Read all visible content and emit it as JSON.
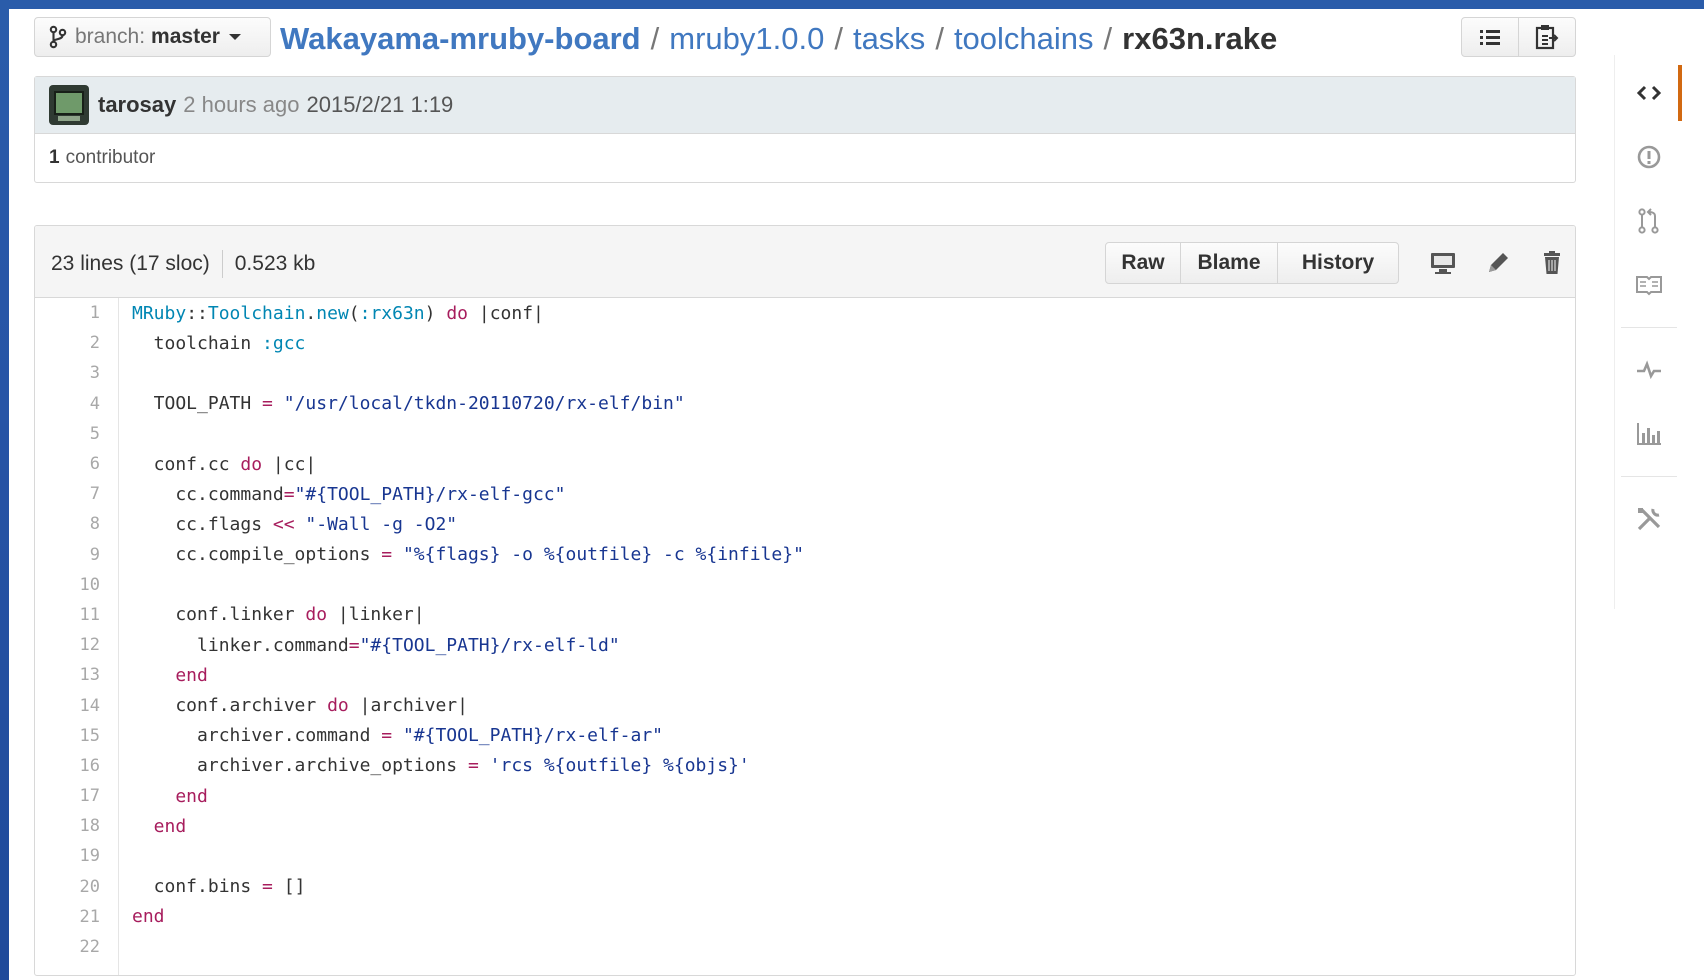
{
  "branch": {
    "label": "branch:",
    "name": "master"
  },
  "breadcrumb": {
    "repo": "Wakayama-mruby-board",
    "sep": "/",
    "parts": [
      "mruby1.0.0",
      "tasks",
      "toolchains"
    ],
    "file": "rx63n.rake"
  },
  "commit": {
    "author": "tarosay",
    "ago": "2 hours ago",
    "date": "2015/2/21 1:19",
    "contributors_count": "1",
    "contributors_label": "contributor"
  },
  "file": {
    "lines_info": "23 lines (17 sloc)",
    "size": "0.523 kb",
    "buttons": {
      "raw": "Raw",
      "blame": "Blame",
      "history": "History"
    }
  },
  "code_lines": [
    [
      [
        "c",
        "MRuby"
      ],
      [
        "p",
        "::"
      ],
      [
        "c",
        "Toolchain"
      ],
      [
        "p",
        "."
      ],
      [
        "c",
        "new"
      ],
      [
        "p",
        "("
      ],
      [
        "c",
        ":rx63n"
      ],
      [
        "p",
        ") "
      ],
      [
        "k",
        "do"
      ],
      [
        "p",
        " |conf|"
      ]
    ],
    [
      [
        "p",
        "  toolchain "
      ],
      [
        "c",
        ":gcc"
      ]
    ],
    [],
    [
      [
        "p",
        "  TOOL_PATH "
      ],
      [
        "k",
        "="
      ],
      [
        "p",
        " "
      ],
      [
        "s",
        "\"/usr/local/tkdn-20110720/rx-elf/bin\""
      ]
    ],
    [],
    [
      [
        "p",
        "  conf.cc "
      ],
      [
        "k",
        "do"
      ],
      [
        "p",
        " |cc|"
      ]
    ],
    [
      [
        "p",
        "    cc.command"
      ],
      [
        "k",
        "="
      ],
      [
        "s",
        "\"#{TOOL_PATH}/rx-elf-gcc\""
      ]
    ],
    [
      [
        "p",
        "    cc.flags "
      ],
      [
        "k",
        "<<"
      ],
      [
        "p",
        " "
      ],
      [
        "s",
        "\"-Wall -g -O2\""
      ]
    ],
    [
      [
        "p",
        "    cc.compile_options "
      ],
      [
        "k",
        "="
      ],
      [
        "p",
        " "
      ],
      [
        "s",
        "\"%{flags} -o %{outfile} -c %{infile}\""
      ]
    ],
    [],
    [
      [
        "p",
        "    conf.linker "
      ],
      [
        "k",
        "do"
      ],
      [
        "p",
        " |linker|"
      ]
    ],
    [
      [
        "p",
        "      linker.command"
      ],
      [
        "k",
        "="
      ],
      [
        "s",
        "\"#{TOOL_PATH}/rx-elf-ld\""
      ]
    ],
    [
      [
        "k",
        "    end"
      ]
    ],
    [
      [
        "p",
        "    conf.archiver "
      ],
      [
        "k",
        "do"
      ],
      [
        "p",
        " |archiver|"
      ]
    ],
    [
      [
        "p",
        "      archiver.command "
      ],
      [
        "k",
        "="
      ],
      [
        "p",
        " "
      ],
      [
        "s",
        "\"#{TOOL_PATH}/rx-elf-ar\""
      ]
    ],
    [
      [
        "p",
        "      archiver.archive_options "
      ],
      [
        "k",
        "="
      ],
      [
        "p",
        " "
      ],
      [
        "s",
        "'rcs %{outfile} %{objs}'"
      ]
    ],
    [
      [
        "k",
        "    end"
      ]
    ],
    [
      [
        "k",
        "  end"
      ]
    ],
    [],
    [
      [
        "p",
        "  conf.bins "
      ],
      [
        "k",
        "="
      ],
      [
        "p",
        " []"
      ]
    ],
    [
      [
        "k",
        "end"
      ]
    ],
    []
  ],
  "icons": {
    "branch": "branch-icon",
    "list": "list-icon",
    "clipboard": "clipboard-icon",
    "desktop": "desktop-icon",
    "pencil": "pencil-icon",
    "trash": "trash-icon",
    "rail": [
      "code-icon",
      "issue-icon",
      "pull-request-icon",
      "wiki-icon",
      "pulse-icon",
      "graph-icon",
      "settings-icon"
    ]
  },
  "colors": {
    "link": "#4078c0",
    "keyword": "#a71d5d",
    "constant": "#0086b3",
    "string": "#183691",
    "active_tab": "#d26911"
  }
}
